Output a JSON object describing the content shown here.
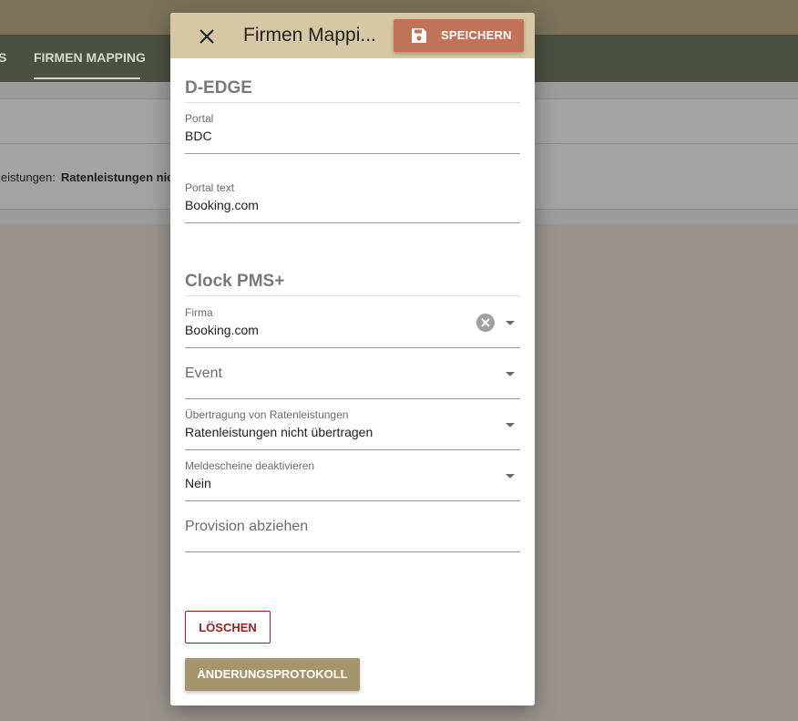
{
  "background": {
    "nav_tab_partial": "S",
    "nav_tab_active": "FIRMEN MAPPING",
    "row_label_partial": "leistungen:",
    "row_value_partial": "Ratenleistungen nic"
  },
  "dialog": {
    "title": "Firmen Mappi...",
    "save_label": "SPEICHERN",
    "section1_title": "D-EDGE",
    "portal": {
      "label": "Portal",
      "value": "BDC"
    },
    "portal_text": {
      "label": "Portal text",
      "value": "Booking.com"
    },
    "section2_title": "Clock PMS+",
    "firma": {
      "label": "Firma",
      "value": "Booking.com"
    },
    "event": {
      "placeholder": "Event"
    },
    "uebertragung": {
      "label": "Übertragung von Ratenleistungen",
      "value": "Ratenleistungen nicht übertragen"
    },
    "meldescheine": {
      "label": "Meldescheine deaktivieren",
      "value": "Nein"
    },
    "provision": {
      "placeholder": "Provision abziehen"
    },
    "delete_label": "LÖSCHEN",
    "log_label": "ÄNDERUNGSPROTOKOLL"
  },
  "colors": {
    "header_bg": "#d6c8a4",
    "save_button": "#c27259",
    "delete_text": "#9b1c1c",
    "log_button": "#a6946d"
  },
  "icons": [
    "close-icon",
    "save-icon",
    "clear-icon",
    "dropdown-arrow-icon"
  ]
}
